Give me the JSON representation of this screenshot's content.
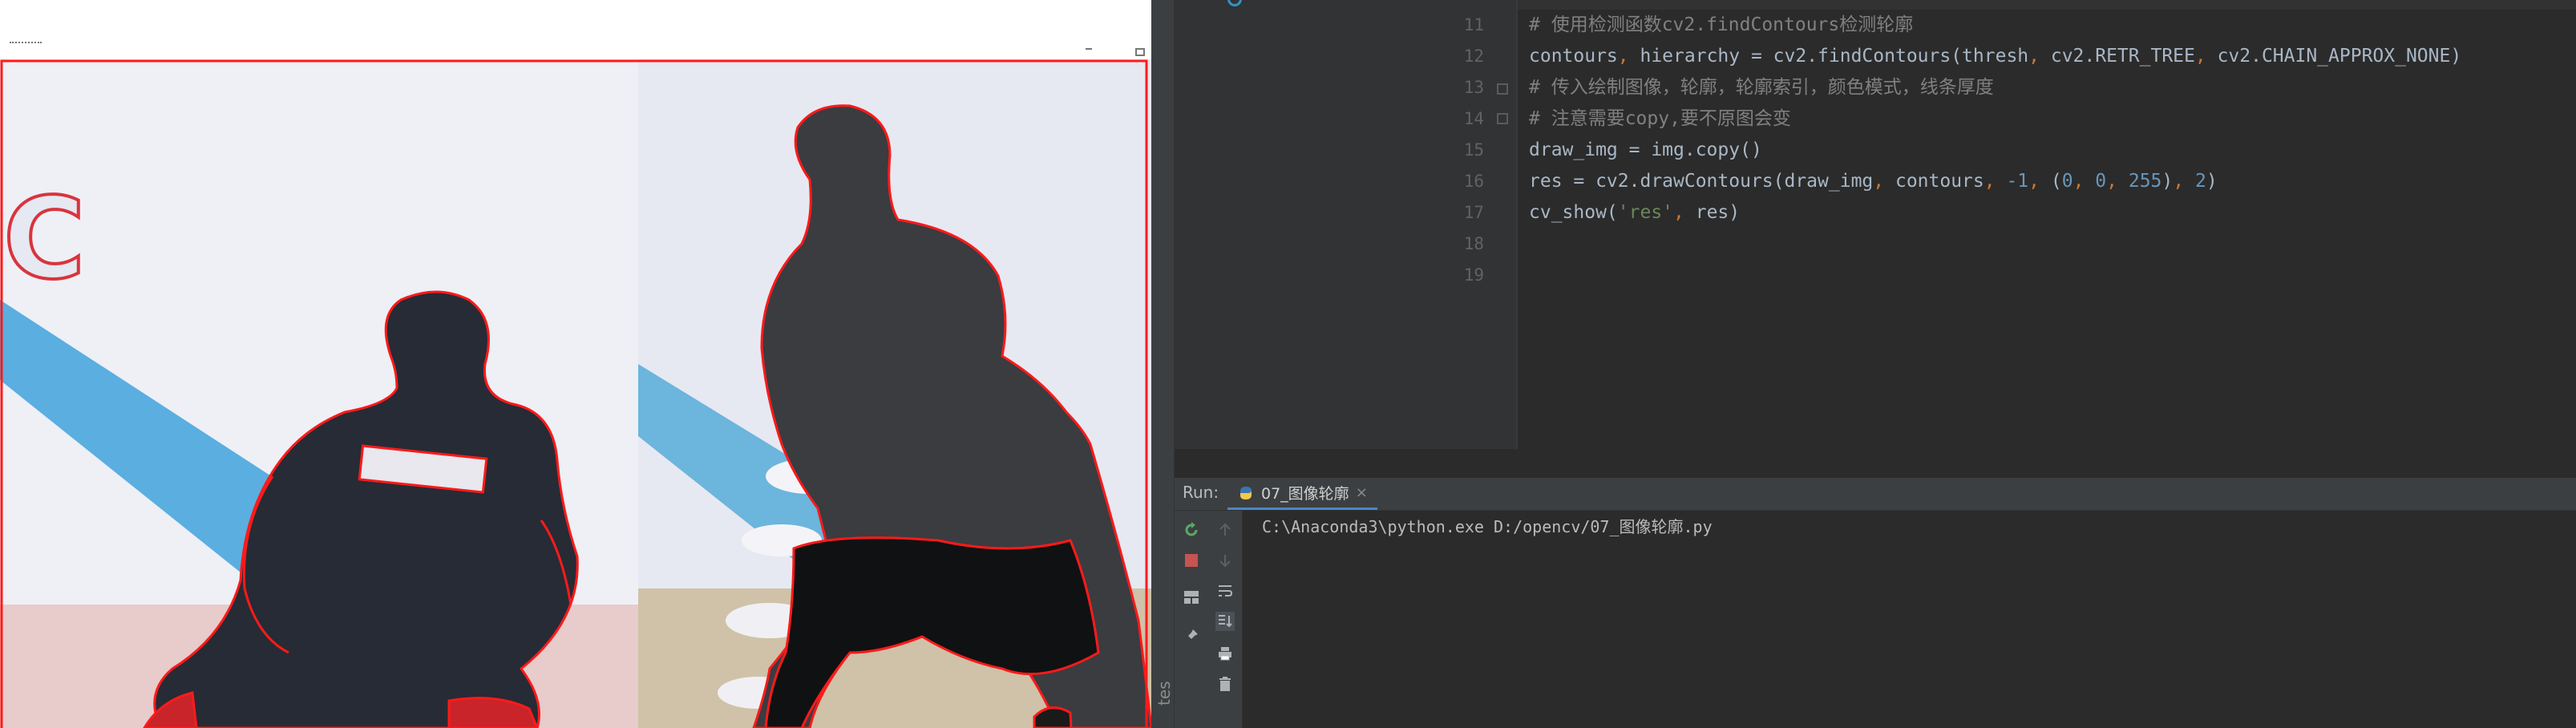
{
  "image_window": {
    "description_icons": [
      "window-menu-icon",
      "minimize-icon",
      "maximize-icon"
    ]
  },
  "editor": {
    "lines": [
      {
        "no": "11",
        "text": "# 使用检测函数cv2.findContours检测轮廓"
      },
      {
        "no": "12",
        "text": "contours, hierarchy = cv2.findContours(thresh, cv2.RETR_TREE, cv2.CHAIN_APPROX_NONE)"
      },
      {
        "no": "13",
        "text": "# 传入绘制图像，轮廓，轮廓索引，颜色模式，线条厚度"
      },
      {
        "no": "14",
        "text": "# 注意需要copy,要不原图会变"
      },
      {
        "no": "15",
        "text": "draw_img = img.copy()"
      },
      {
        "no": "16",
        "text": "res = cv2.drawContours(draw_img, contours, -1, (0, 0, 255), 2)"
      },
      {
        "no": "17",
        "text": "cv_show('res', res)"
      },
      {
        "no": "18",
        "text": ""
      },
      {
        "no": "19",
        "text": ""
      }
    ],
    "code": {
      "l11": "# 使用检测函数cv2.findContours检测轮廓",
      "l12_a": "contours",
      "l12_b": ", ",
      "l12_c": "hierarchy = cv2.findContours(thresh",
      "l12_d": ", ",
      "l12_e": "cv2.RETR_TREE",
      "l12_f": ", ",
      "l12_g": "cv2.CHAIN_APPROX_NONE)",
      "l13": "# 传入绘制图像，轮廓，轮廓索引，颜色模式，线条厚度",
      "l14": "# 注意需要copy,要不原图会变",
      "l15": "draw_img = img.copy()",
      "l16_a": "res = cv2.drawContours(draw_img",
      "l16_b": ", ",
      "l16_c": "contours",
      "l16_d": ", ",
      "l16_e": "-1",
      "l16_f": ", ",
      "l16_g": "(",
      "l16_h": "0",
      "l16_i": ", ",
      "l16_j": "0",
      "l16_k": ", ",
      "l16_l": "255",
      "l16_m": ")",
      "l16_n": ", ",
      "l16_o": "2",
      "l16_p": ")",
      "l17_a": "cv_show(",
      "l17_b": "'res'",
      "l17_c": ", ",
      "l17_d": "res)"
    }
  },
  "run_panel": {
    "label": "Run:",
    "tab_label": "07_图像轮廓",
    "close": "×",
    "console_output": "C:\\Anaconda3\\python.exe D:/opencv/07_图像轮廓.py"
  },
  "side_strip_label": "tes",
  "colors": {
    "editor_bg": "#2b2b2b",
    "comment": "#808080",
    "string": "#6a8759",
    "number": "#6897bb",
    "keyword": "#cc7832",
    "contour": "#ff0000"
  }
}
